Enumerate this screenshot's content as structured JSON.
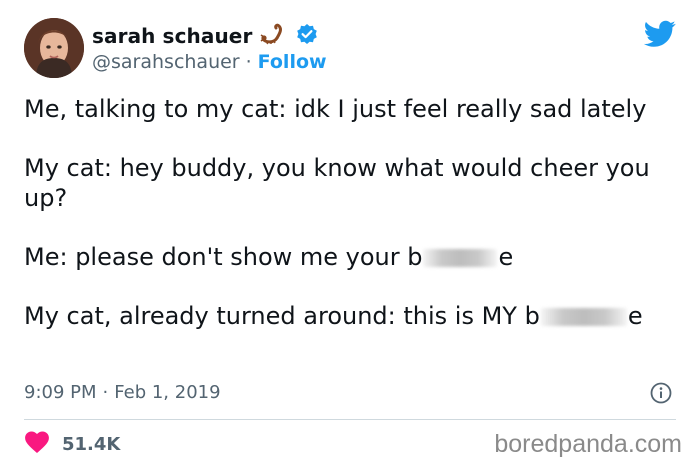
{
  "author": {
    "name": "sarah schauer",
    "handle": "@sarahschauer",
    "separator": "·",
    "follow_label": "Follow",
    "verified_color": "#1d9bf0",
    "name_emoji": "scorpion-icon"
  },
  "tweet": {
    "paragraphs": [
      {
        "text": "Me, talking to my cat: idk I just feel really sad lately"
      },
      {
        "text": "My cat: hey buddy, you know what would cheer you up?"
      },
      {
        "prefix": "Me: please don't show me your b",
        "suffix": "e"
      },
      {
        "prefix": "My cat, already turned around: this is MY b",
        "suffix": "e"
      }
    ],
    "time": "9:09 PM",
    "date": "Feb 1, 2019",
    "dot": "·"
  },
  "stats": {
    "likes": "51.4K",
    "like_color": "#f91880"
  },
  "watermark": "boredpanda.com",
  "colors": {
    "accent": "#1d9bf0",
    "secondary_text": "#536471"
  }
}
